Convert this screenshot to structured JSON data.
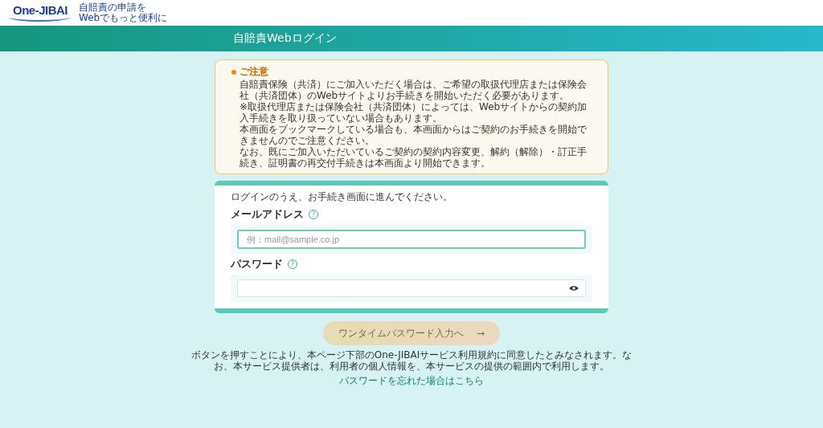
{
  "header": {
    "logo": "One-JIBAI",
    "tagline": [
      "自賠責の申請を",
      "Webでもっと便利に"
    ]
  },
  "page_title": "自賠責Webログイン",
  "notice": {
    "heading": "ご注意",
    "paragraphs": [
      "自賠責保険（共済）にご加入いただく場合は、ご希望の取扱代理店または保険会社（共済団体）のWebサイトよりお手続きを開始いただく必要があります。",
      "※取扱代理店または保険会社（共済団体）によっては、Webサイトからの契約加入手続きを取り扱っていない場合もあります。",
      "本画面をブックマークしている場合も、本画面からはご契約のお手続きを開始できませんのでご注意ください。",
      "なお、既にご加入いただいているご契約の契約内容変更、解約（解除）・訂正手続き、証明書の再交付手続きは本画面より開始できます。"
    ]
  },
  "login": {
    "intro": "ログインのうえ、お手続き画面に進んでください。",
    "fields": [
      {
        "kind": "email",
        "label": "メールアドレス",
        "help": "?",
        "placeholder": "例：mail@sample.co.jp",
        "focused": true
      },
      {
        "kind": "password",
        "label": "パスワード",
        "help": "?",
        "focused": false
      }
    ]
  },
  "submit": {
    "label": "ワンタイムパスワード入力へ",
    "arrow": "→",
    "disabled": true
  },
  "terms": "ボタンを押すことにより、本ページ下部のOne-JIBAIサービス利用規約に同意したとみなされます。なお、本サービス提供者は、利用者の個人情報を、本サービスの提供の範囲内で利用します。",
  "forgot_link": "パスワードを忘れた場合はこちら"
}
